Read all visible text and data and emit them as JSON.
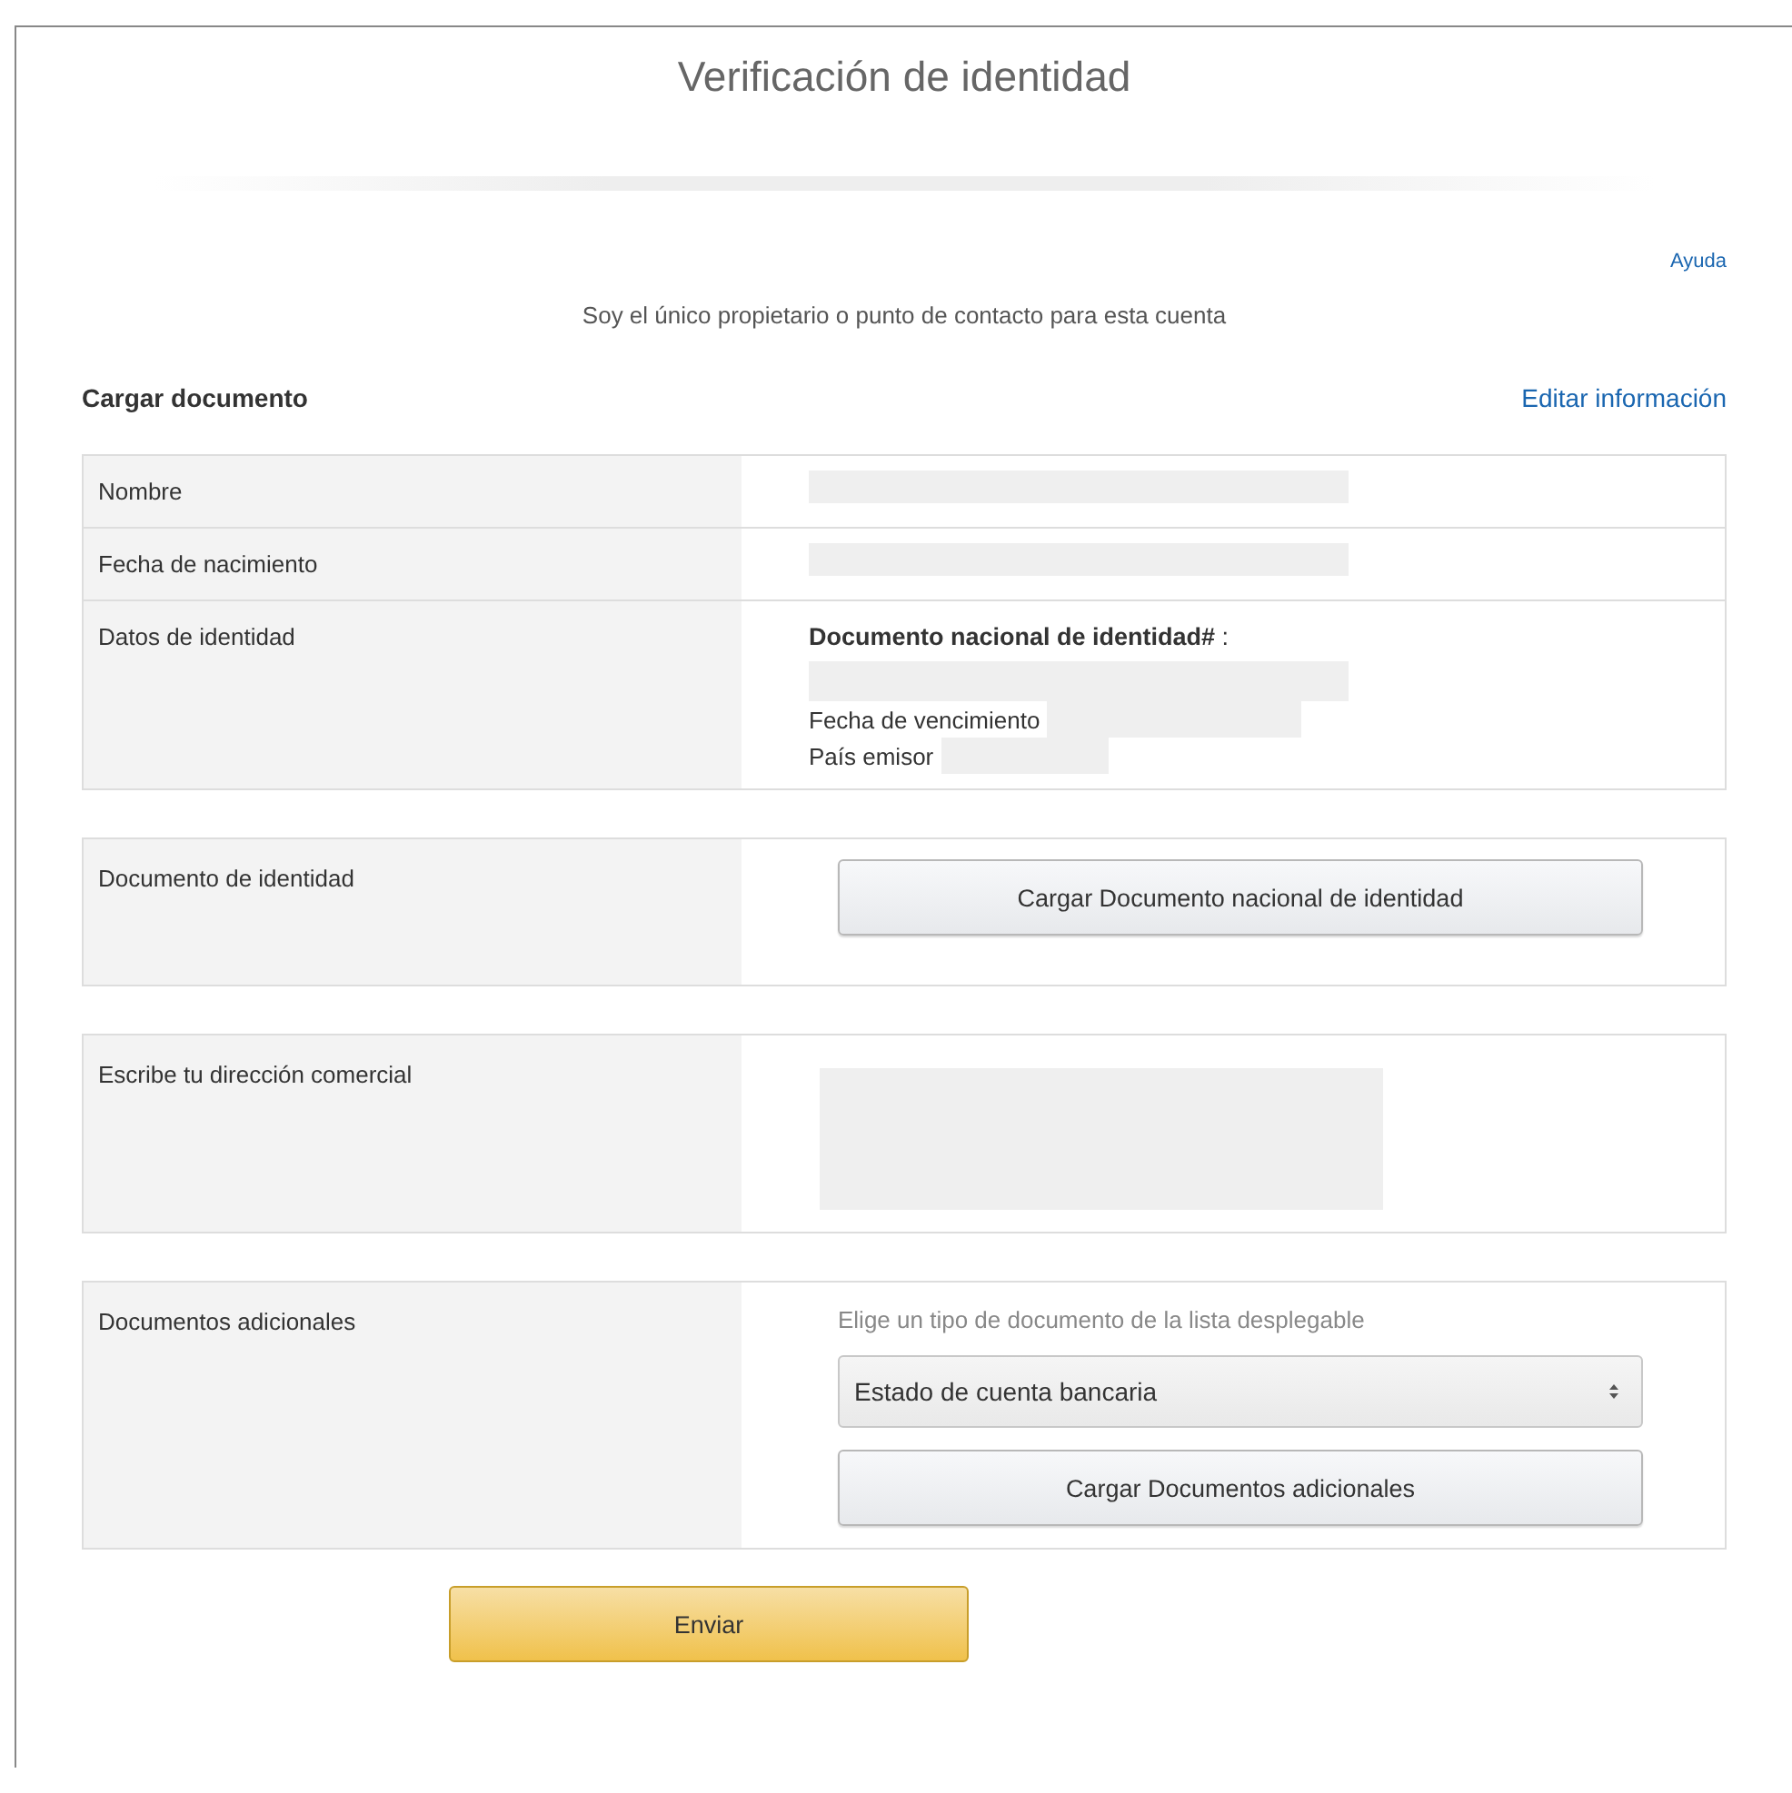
{
  "title": "Verificación de identidad",
  "help_link": "Ayuda",
  "subtitle": "Soy el único propietario o punto de contacto para esta cuenta",
  "section_title": "Cargar documento",
  "edit_link": "Editar información",
  "info_rows": [
    {
      "label": "Nombre",
      "kind": "redacted"
    },
    {
      "label": "Fecha de nacimiento",
      "kind": "redacted"
    },
    {
      "label": "Datos de identidad",
      "kind": "id_details",
      "heading": "**Documento nacional de identidad#** :",
      "fields": [
        "Fecha de vencimiento",
        "País emisor"
      ]
    }
  ],
  "sections": [
    {
      "label": "Documento de identidad",
      "kind": "upload",
      "button": "Cargar Documento nacional de identidad"
    },
    {
      "label": "Escribe tu dirección comercial",
      "kind": "redacted_block"
    },
    {
      "label": "Documentos adicionales",
      "kind": "select_upload",
      "hint": "Elige un tipo de documento de la lista desplegable",
      "select": "Estado de cuenta bancaria",
      "button": "Cargar Documentos adicionales"
    }
  ],
  "submit": "Enviar"
}
